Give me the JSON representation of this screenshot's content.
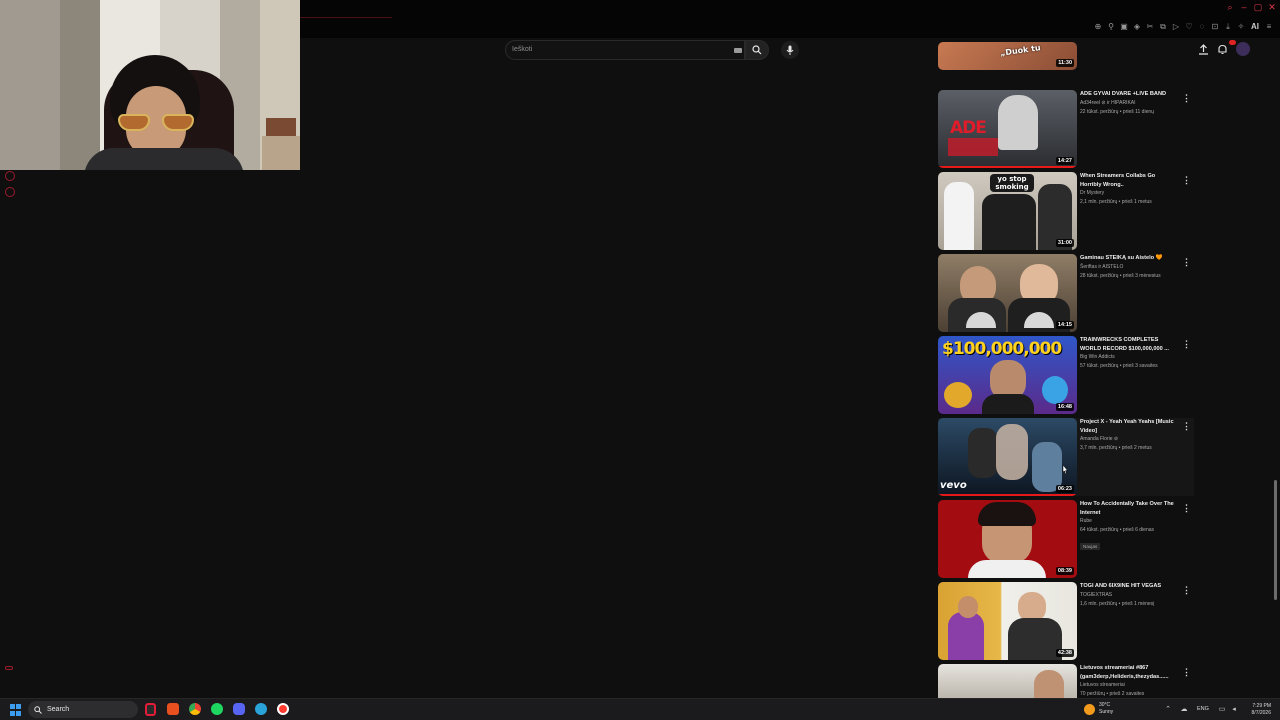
{
  "browser": {
    "toolbar_ai_label": "AI"
  },
  "search": {
    "placeholder": "Ieškoti"
  },
  "videos": [
    {
      "title": "",
      "channel": "",
      "stats": "",
      "duration": "11:30",
      "thumb_text": "„Duok tu",
      "partial": true
    },
    {
      "title": "ADE GYVAI DVARE +LIVE BAND",
      "channel": "Ad34reel ⊘ ir HIPARIKAI",
      "stats": "22 tūkst. peržiūrų • prieš 11 dienų",
      "duration": "14:27",
      "thumb_text": "ADE",
      "progress": 1.0
    },
    {
      "title": "When Streamers Collabs Go Horribly Wrong..",
      "channel": "Dr Mystery",
      "stats": "2,1 mln. peržiūrų • prieš 1 metus",
      "duration": "31:00",
      "thumb_text": "yo stop smoking"
    },
    {
      "title": "Gaminau STEIKĄ su Aistelo 🧡",
      "channel": "Šeriftas ir AISTELO",
      "stats": "28 tūkst. peržiūrų • prieš 3 mėnesius",
      "duration": "14:15",
      "thumb_text": ""
    },
    {
      "title": "TRAINWRECKS COMPLETES WORLD RECORD $100,000,000 ...",
      "channel": "Big Win Addicts",
      "stats": "57 tūkst. peržiūrų • prieš 3 savaites",
      "duration": "16:48",
      "thumb_text": "$100,000,000"
    },
    {
      "title": "Project X - Yeah Yeah Yeahs [Music Video]",
      "channel": "Amanda Florie ⊘",
      "stats": "3,7 mln. peržiūrų • prieš 2 metus",
      "duration": "06:23",
      "thumb_text": "vevo",
      "progress": 1.0
    },
    {
      "title": "How To Accidentally Take Over The Internet",
      "channel": "Rube",
      "stats": "64 tūkst. peržiūrų • prieš 6 dienas",
      "duration": "08:39",
      "thumb_text": "",
      "badge": "Naujas"
    },
    {
      "title": "TOGI AND 6IX9INE HIT VEGAS",
      "channel": "TOGIEXTRAS",
      "stats": "1,6 mln. peržiūrų • prieš 1 mėnesį",
      "duration": "42:38",
      "thumb_text": ""
    },
    {
      "title": "Lietuvos streameriai #867 (gam3derp,Helideris,thezydas......",
      "channel": "Lietuvos streameriai",
      "stats": "70 peržiūrų • prieš 2 savaites",
      "duration": "",
      "thumb_text": ""
    }
  ],
  "taskbar": {
    "search_label": "Search",
    "weather_temp": "30°C",
    "weather_desc": "Sunny",
    "language": "ENG",
    "time": "7:29 PM",
    "date": "8/7/2026"
  },
  "colors": {
    "accent_red": "#e51919",
    "background": "#0f0f0f"
  }
}
